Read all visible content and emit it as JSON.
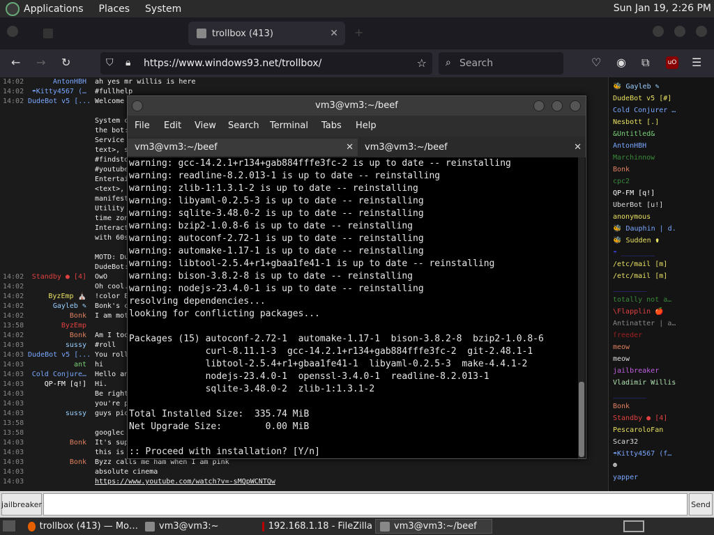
{
  "topbar": {
    "menus": [
      "Applications",
      "Places",
      "System"
    ],
    "clock": "Sun Jan 19,  2:26 PM"
  },
  "browser": {
    "tabs": [
      {
        "label": "",
        "active": false
      },
      {
        "label": "trollbox (413)",
        "active": true
      }
    ],
    "url": "https://www.windows93.net/trollbox/",
    "search_placeholder": "Search"
  },
  "chat": {
    "rows": [
      {
        "time": "14:02",
        "nick": "AntonHBH",
        "color": "#7aa8ff",
        "msg": "ah yes mr willis is here"
      },
      {
        "time": "14:02",
        "nick": "☂Kitty4567 (…",
        "color": "#7aa8ff",
        "msg": "#fullhelp"
      },
      {
        "time": "14:02",
        "nick": "DudeBot v5 [...",
        "color": "#7aa8ff",
        "msg": "Welcome"
      },
      {
        "time": "",
        "nick": "",
        "color": "#ddd",
        "msg": ""
      },
      {
        "time": "",
        "nick": "",
        "color": "#ddd",
        "msg": "System c"
      },
      {
        "time": "",
        "nick": "",
        "color": "#ddd",
        "msg": "the bot:"
      },
      {
        "time": "",
        "nick": "",
        "color": "#ddd",
        "msg": "Service"
      },
      {
        "time": "",
        "nick": "",
        "color": "#ddd",
        "msg": "text>, s"
      },
      {
        "time": "",
        "nick": "",
        "color": "#ddd",
        "msg": "#findsto"
      },
      {
        "time": "",
        "nick": "",
        "color": "#ddd",
        "msg": "#youtube"
      },
      {
        "time": "",
        "nick": "",
        "color": "#ddd",
        "msg": "Entertai"
      },
      {
        "time": "",
        "nick": "",
        "color": "#ddd",
        "msg": "<text>,"
      },
      {
        "time": "",
        "nick": "",
        "color": "#ddd",
        "msg": "manifest"
      },
      {
        "time": "",
        "nick": "",
        "color": "#ddd",
        "msg": "Utility"
      },
      {
        "time": "",
        "nick": "",
        "color": "#ddd",
        "msg": "time zon"
      },
      {
        "time": "",
        "nick": "",
        "color": "#ddd",
        "msg": "Interact"
      },
      {
        "time": "",
        "nick": "",
        "color": "#ddd",
        "msg": "with 60s"
      },
      {
        "time": "",
        "nick": "",
        "color": "#ddd",
        "msg": ""
      },
      {
        "time": "",
        "nick": "",
        "color": "#ddd",
        "msg": "MOTD: Du"
      },
      {
        "time": "",
        "nick": "",
        "color": "#ddd",
        "msg": "DudeBot:"
      },
      {
        "time": "14:02",
        "nick": "Standby ● [4]",
        "color": "#e04040",
        "msg": "OwO"
      },
      {
        "time": "14:02",
        "nick": "",
        "color": "#3a3ad0",
        "msg": "Oh cool."
      },
      {
        "time": "14:02",
        "nick": "ByzEmp ⛪",
        "color": "#e8e060",
        "msg": "!color E"
      },
      {
        "time": "14:02",
        "nick": "Gayleb ✎",
        "color": "#9ad0ff",
        "msg": "Bonk's c"
      },
      {
        "time": "14:02",
        "nick": "Bonk",
        "color": "#e08060",
        "msg": "I am mot"
      },
      {
        "time": "13:58",
        "nick": "ByzEmp",
        "color": "#e04040",
        "msg": ""
      },
      {
        "time": "14:02",
        "nick": "Bonk",
        "color": "#e08060",
        "msg": "Am I too"
      },
      {
        "time": "14:03",
        "nick": "sussy",
        "color": "#9ad0ff",
        "msg": "#roll"
      },
      {
        "time": "14:03",
        "nick": "DudeBot v5 [...",
        "color": "#7aa8ff",
        "msg": "You roll"
      },
      {
        "time": "14:03",
        "nick": "ant",
        "color": "#7ad07a",
        "msg": "hi"
      },
      {
        "time": "14:03",
        "nick": "Cold Conjure…",
        "color": "#7aa8ff",
        "msg": "Hello an"
      },
      {
        "time": "14:03",
        "nick": "QP-FM [q!]",
        "color": "#ffffff",
        "msg": "Hi."
      },
      {
        "time": "14:03",
        "nick": "",
        "color": "#3a3ad0",
        "msg": "Be right"
      },
      {
        "time": "14:03",
        "nick": "",
        "color": "#e04040",
        "msg": "you're p"
      },
      {
        "time": "14:03",
        "nick": "sussy",
        "color": "#9ad0ff",
        "msg": "guys pic"
      },
      {
        "time": "13:58",
        "nick": "",
        "color": "#3a3ad0",
        "msg": ""
      },
      {
        "time": "13:58",
        "nick": "",
        "color": "#e04040",
        "msg": "googlec"
      },
      {
        "time": "14:03",
        "nick": "Bonk",
        "color": "#e08060",
        "msg": "It's sup"
      },
      {
        "time": "14:03",
        "nick": "",
        "color": "#e04040",
        "msg": "this is"
      },
      {
        "time": "14:03",
        "nick": "Bonk",
        "color": "#e08060",
        "msg": "Byzz calls me ham when I am pink"
      },
      {
        "time": "14:03",
        "nick": "",
        "color": "#e04040",
        "msg": "absolute cinema"
      },
      {
        "time": "14:03",
        "nick": "",
        "color": "#e04040",
        "msg": "https://www.youtube.com/watch?v=-sMQpWCNTQw"
      }
    ]
  },
  "userlist": {
    "users": [
      {
        "name": "🐝 Gayleb ✎",
        "color": "#9ad0ff"
      },
      {
        "name": "DudeBot v5 [#]",
        "color": "#e8e060"
      },
      {
        "name": "Cold Conjurer …",
        "color": "#7aa8ff"
      },
      {
        "name": "Nesbott [.]",
        "color": "#e8e060"
      },
      {
        "name": "&Untitled&",
        "color": "#7ad07a"
      },
      {
        "name": "AntonHBH",
        "color": "#7aa8ff"
      },
      {
        "name": "Marchinnow",
        "color": "#3a8a3a"
      },
      {
        "name": "Bonk",
        "color": "#e08060"
      },
      {
        "name": "cpc2",
        "color": "#3a8a3a"
      },
      {
        "name": "QP-FM [q!]",
        "color": "#ffffff"
      },
      {
        "name": "UberBot [u!]",
        "color": "#dddddd"
      },
      {
        "name": "anonymous",
        "color": "#e8e060"
      },
      {
        "name": "🐝 Dauphin | d.",
        "color": "#7aa8ff"
      },
      {
        "name": "🐝 Sudden ⚱",
        "color": "#e8e060"
      },
      {
        "name": "☂ ________",
        "color": "#3a3ad0"
      },
      {
        "name": "/etc/mail [m]",
        "color": "#e8e060"
      },
      {
        "name": "/etc/mail [m]",
        "color": "#e8e060"
      },
      {
        "name": "________",
        "color": "#3a3ad0"
      },
      {
        "name": "totally not a…",
        "color": "#3a8a3a"
      },
      {
        "name": "\\Flapplin 🍎",
        "color": "#e04040"
      },
      {
        "name": "Antinatter | a…",
        "color": "#888888"
      },
      {
        "name": "ſreeder",
        "color": "#a02020"
      },
      {
        "name": "meow",
        "color": "#e08060"
      },
      {
        "name": "meow",
        "color": "#dddddd"
      },
      {
        "name": "jailbreaker",
        "color": "#c060e0"
      },
      {
        "name": "Vladimir Willis",
        "color": "#b0e0b0"
      },
      {
        "name": "________",
        "color": "#3a3ad0"
      },
      {
        "name": "Bonk",
        "color": "#e08060"
      },
      {
        "name": "Standby ● [4]",
        "color": "#e04040"
      },
      {
        "name": "PescaroloFan",
        "color": "#e8e060"
      },
      {
        "name": "Scar32",
        "color": "#dddddd"
      },
      {
        "name": "☂Kitty4567 (f…",
        "color": "#7aa8ff"
      },
      {
        "name": "☻",
        "color": "#dddddd"
      },
      {
        "name": "yapper",
        "color": "#7aa8ff"
      }
    ]
  },
  "input": {
    "nick": "jailbreaker",
    "value": "",
    "send": "Send"
  },
  "terminal": {
    "title": "vm3@vm3:~/beef",
    "menus": [
      "File",
      "Edit",
      "View",
      "Search",
      "Terminal",
      "Tabs",
      "Help"
    ],
    "tabs": [
      "vm3@vm3:~/beef",
      "vm3@vm3:~/beef"
    ],
    "scroll_thumb_fraction": 0.25,
    "lines": [
      "warning: gcc-14.2.1+r134+gab884fffe3fc-2 is up to date -- reinstalling",
      "warning: readline-8.2.013-1 is up to date -- reinstalling",
      "warning: zlib-1:1.3.1-2 is up to date -- reinstalling",
      "warning: libyaml-0.2.5-3 is up to date -- reinstalling",
      "warning: sqlite-3.48.0-2 is up to date -- reinstalling",
      "warning: bzip2-1.0.8-6 is up to date -- reinstalling",
      "warning: autoconf-2.72-1 is up to date -- reinstalling",
      "warning: automake-1.17-1 is up to date -- reinstalling",
      "warning: libtool-2.5.4+r1+gbaa1fe41-1 is up to date -- reinstalling",
      "warning: bison-3.8.2-8 is up to date -- reinstalling",
      "warning: nodejs-23.4.0-1 is up to date -- reinstalling",
      "resolving dependencies...",
      "looking for conflicting packages...",
      "",
      "Packages (15) autoconf-2.72-1  automake-1.17-1  bison-3.8.2-8  bzip2-1.0.8-6",
      "              curl-8.11.1-3  gcc-14.2.1+r134+gab884fffe3fc-2  git-2.48.1-1",
      "              libtool-2.5.4+r1+gbaa1fe41-1  libyaml-0.2.5-3  make-4.4.1-2",
      "              nodejs-23.4.0-1  openssl-3.4.0-1  readline-8.2.013-1",
      "              sqlite-3.48.0-2  zlib-1:1.3.1-2",
      "",
      "Total Installed Size:  335.74 MiB",
      "Net Upgrade Size:        0.00 MiB",
      "",
      ":: Proceed with installation? [Y/n]"
    ]
  },
  "taskbar": {
    "items": [
      {
        "label": "trollbox (413) — Mo…",
        "active": false
      },
      {
        "label": "vm3@vm3:~",
        "active": false
      },
      {
        "label": "192.168.1.18 - FileZilla",
        "active": false
      },
      {
        "label": "vm3@vm3:~/beef",
        "active": true
      }
    ]
  }
}
